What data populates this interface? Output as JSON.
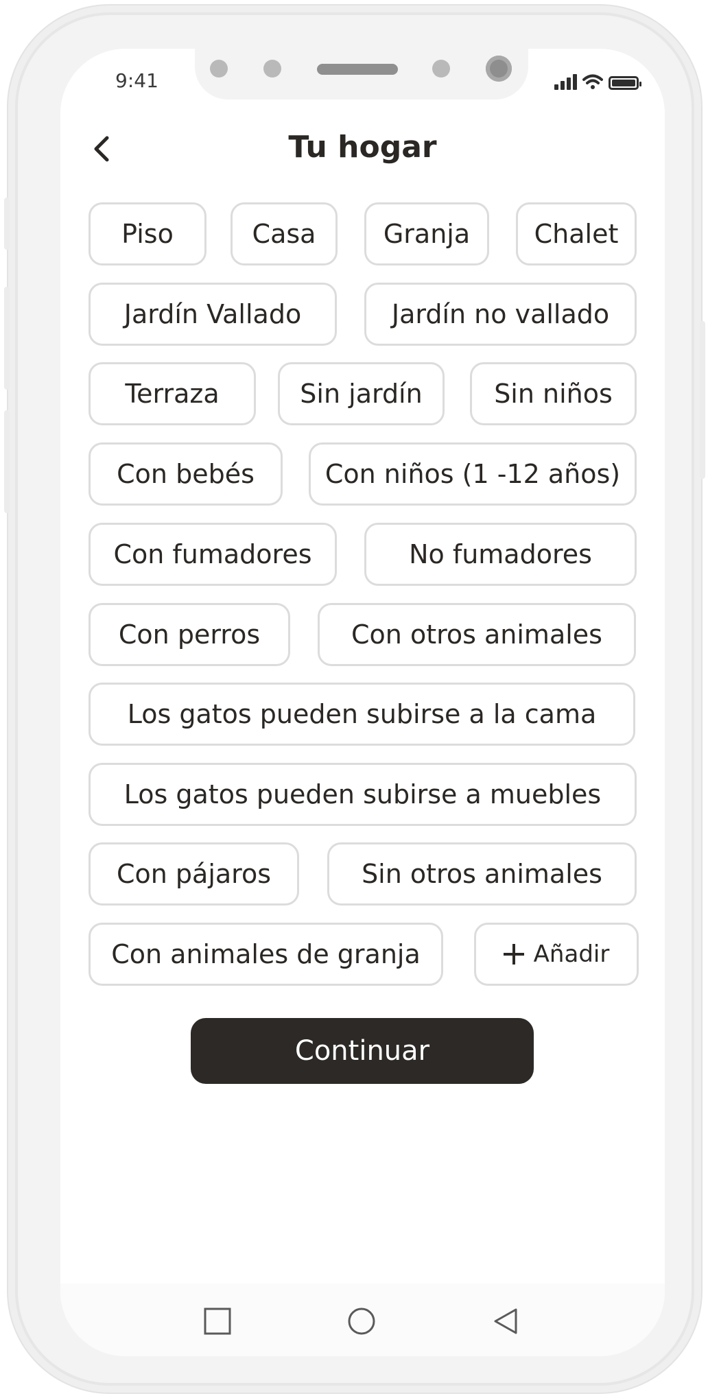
{
  "status_bar": {
    "time": "9:41"
  },
  "header": {
    "title": "Tu hogar",
    "back_icon": "chevron-left-icon"
  },
  "chips": [
    "Piso",
    "Casa",
    "Granja",
    "Chalet",
    "Jardín Vallado",
    "Jardín no vallado",
    "Terraza",
    "Sin jardín",
    "Sin niños",
    "Con bebés",
    "Con niños (1 -12 años)",
    "Con fumadores",
    "No fumadores",
    "Con perros",
    "Con otros animales",
    "Los gatos pueden subirse a la cama",
    "Los gatos pueden subirse a muebles",
    "Con pájaros",
    "Sin otros animales",
    "Con animales de granja"
  ],
  "add_button": {
    "label": "Añadir",
    "icon": "plus-icon"
  },
  "continue_button": {
    "label": "Continuar"
  },
  "colors": {
    "button_bg": "#2c2926",
    "chip_border": "#dcdcdc",
    "text": "#2a2724"
  },
  "navbar": {
    "icons": [
      "square-icon",
      "circle-icon",
      "triangle-back-icon"
    ]
  }
}
